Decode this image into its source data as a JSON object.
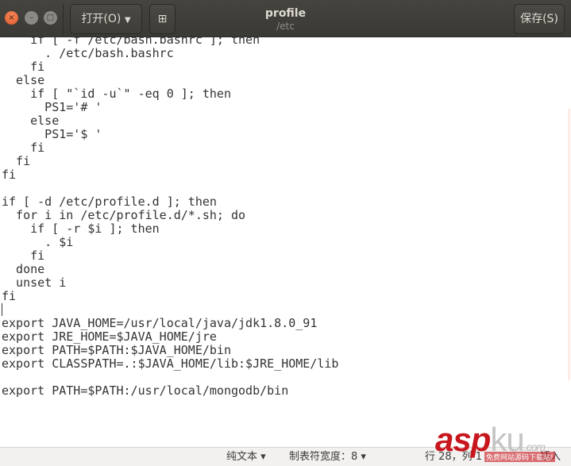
{
  "window": {
    "title": "profile",
    "subtitle": "/etc"
  },
  "toolbar": {
    "open_label": "打开(O)",
    "save_label": "保存(S)",
    "new_tab_icon": "new-document-icon"
  },
  "editor": {
    "lines": [
      "    if [ -f /etc/bash.bashrc ]; then",
      "      . /etc/bash.bashrc",
      "    fi",
      "  else",
      "    if [ \"`id -u`\" -eq 0 ]; then",
      "      PS1='# '",
      "    else",
      "      PS1='$ '",
      "    fi",
      "  fi",
      "fi",
      "",
      "if [ -d /etc/profile.d ]; then",
      "  for i in /etc/profile.d/*.sh; do",
      "    if [ -r $i ]; then",
      "      . $i",
      "    fi",
      "  done",
      "  unset i",
      "fi",
      "",
      "export JAVA_HOME=/usr/local/java/jdk1.8.0_91",
      "export JRE_HOME=$JAVA_HOME/jre",
      "export PATH=$PATH:$JAVA_HOME/bin",
      "export CLASSPATH=.:$JAVA_HOME/lib:$JRE_HOME/lib",
      "",
      "export PATH=$PATH:/usr/local/mongodb/bin"
    ]
  },
  "statusbar": {
    "language": "纯文本 ▾",
    "tab_width": "制表符宽度：8 ▾",
    "position": "行 28，列 1",
    "mode": "插入"
  },
  "watermark": {
    "brand": "asp",
    "brand2": "ku",
    "domain": ".com",
    "slogan": "免费网站源码下载站!"
  }
}
